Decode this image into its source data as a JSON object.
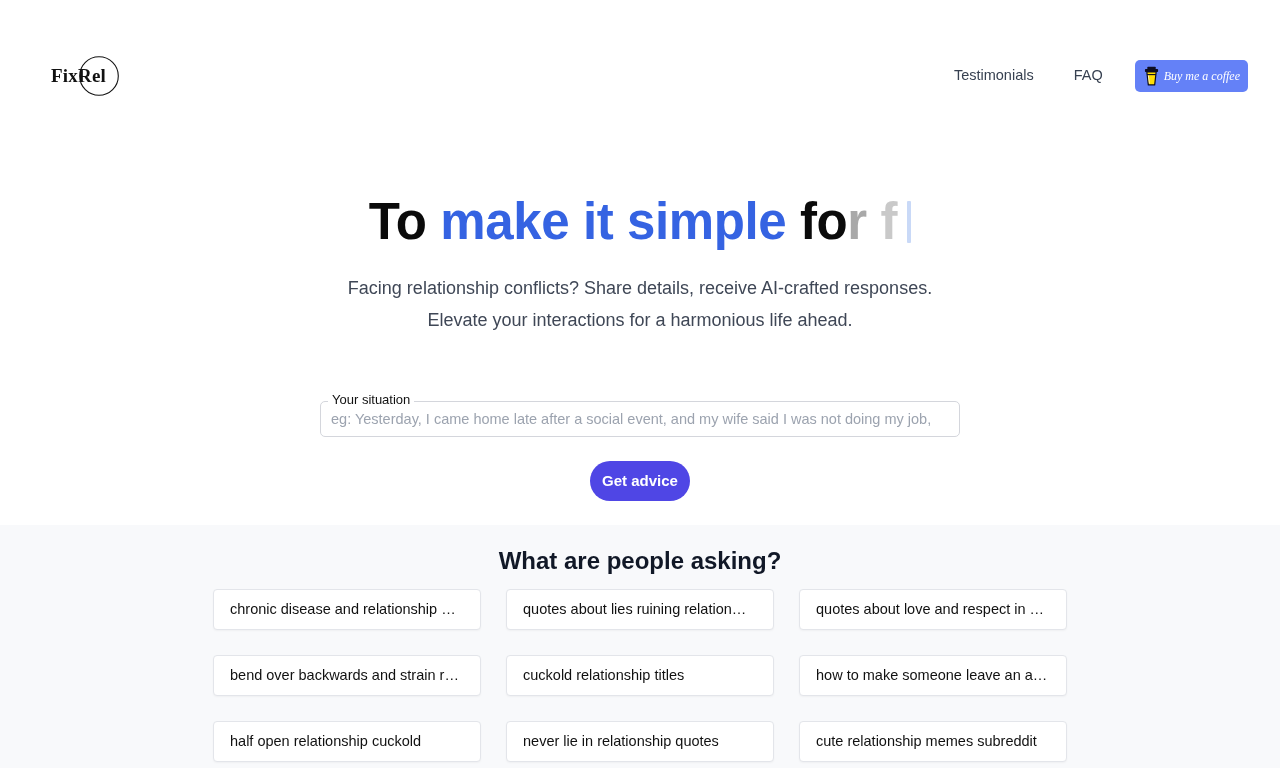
{
  "header": {
    "logo": "FixRel",
    "nav_links": [
      "Testimonials",
      "FAQ"
    ],
    "support_button": "Buy me a coffee"
  },
  "hero": {
    "headline": [
      {
        "text": "To ",
        "kind": "plain"
      },
      {
        "text": "make it simple",
        "kind": "accent"
      },
      {
        "text": " fo",
        "kind": "plain"
      },
      {
        "text": "r",
        "kind": "fading"
      },
      {
        "text": " f",
        "kind": "ghost"
      }
    ],
    "subtitle_lines": [
      "Facing relationship conflicts? Share details, receive AI-crafted responses.",
      "Elevate your interactions for a harmonious life ahead."
    ],
    "situation_field": {
      "label": "Your situation",
      "placeholder": "eg: Yesterday, I came home late after a social event, and my wife said I was not doing my job,"
    },
    "submit_button": "Get advice"
  },
  "questions": {
    "title": "What are people asking?",
    "items": [
      "chronic disease and relationship …",
      "quotes about lies ruining relation…",
      "quotes about love and respect in …",
      "bend over backwards and strain r…",
      "cuckold relationship titles",
      "how to make someone leave an a…",
      "half open relationship cuckold",
      "never lie in relationship quotes",
      "cute relationship memes subreddit"
    ]
  }
}
